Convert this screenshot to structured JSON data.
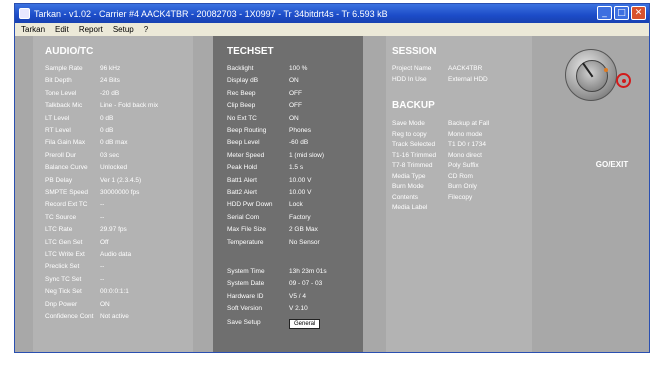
{
  "window": {
    "title": "Tarkan - v1.02 - Carrier #4   AACK4TBR - 20082703 - 1X0997   - Tr 34bitdrt4s - Tr 6.593 kB",
    "menu": [
      "Tarkan",
      "Edit",
      "Report",
      "Setup",
      "?"
    ],
    "buttons": {
      "minimize": "_",
      "maximize": "□",
      "close": "✕"
    }
  },
  "audio": {
    "title": "AUDIO/TC",
    "rows": [
      {
        "k": "Sample Rate",
        "v": "96 kHz"
      },
      {
        "k": "Bit Depth",
        "v": "24 Bits"
      },
      {
        "k": "Tone Level",
        "v": "-20 dB"
      },
      {
        "k": "Talkback Mic",
        "v": "Line - Fold back mix"
      },
      {
        "k": "LT Level",
        "v": "0 dB"
      },
      {
        "k": "RT Level",
        "v": "0 dB"
      },
      {
        "k": "Fila Gain Max",
        "v": "0 dB max"
      },
      {
        "k": "Preroll Dur",
        "v": "03 sec"
      },
      {
        "k": "Balance Curve",
        "v": "Unlocked"
      },
      {
        "k": "PB Delay",
        "v": "Ver 1 (2.3.4.5)"
      },
      {
        "k": "SMPTE Speed",
        "v": "30000000 fps"
      },
      {
        "k": "Record Ext TC",
        "v": "--"
      },
      {
        "k": "TC Source",
        "v": "--"
      },
      {
        "k": "LTC Rate",
        "v": "29.97 fps"
      },
      {
        "k": "LTC Gen Set",
        "v": "Off"
      },
      {
        "k": "LTC Write Ext",
        "v": "Audio data"
      },
      {
        "k": "Preclick Set",
        "v": "--"
      },
      {
        "k": "Sync TC Set",
        "v": "--"
      },
      {
        "k": "Neg Tick Set",
        "v": "00:0:0:1:1"
      },
      {
        "k": "Dnp Power",
        "v": "ON"
      },
      {
        "k": "Confidence Cont",
        "v": "Not active"
      }
    ]
  },
  "techset": {
    "title": "TECHSET",
    "rows": [
      {
        "k": "Backlight",
        "v": "100 %"
      },
      {
        "k": "Display dB",
        "v": "ON"
      },
      {
        "k": "Rec Beep",
        "v": "OFF"
      },
      {
        "k": "Clip Beep",
        "v": "OFF"
      },
      {
        "k": "No Ext TC",
        "v": "ON"
      },
      {
        "k": "Beep Routing",
        "v": "Phones"
      },
      {
        "k": "Beep Level",
        "v": "-60 dB"
      },
      {
        "k": "Meter Speed",
        "v": "1 (mid slow)"
      },
      {
        "k": "Peak Hold",
        "v": "1.5 s"
      },
      {
        "k": "Batt1 Alert",
        "v": "10.00 V"
      },
      {
        "k": "Batt2 Alert",
        "v": "10.00 V"
      },
      {
        "k": "HDD Pwr Down",
        "v": "Lock"
      },
      {
        "k": "Serial Com",
        "v": "Factory"
      },
      {
        "k": "Max File Size",
        "v": "2 GB Max"
      },
      {
        "k": "Temperature",
        "v": "No Sensor"
      }
    ],
    "system": [
      {
        "k": "System Time",
        "v": "13h 23m 01s"
      },
      {
        "k": "System Date",
        "v": "09 - 07 - 03"
      },
      {
        "k": "Hardware ID",
        "v": "V5 / 4"
      },
      {
        "k": "Soft Version",
        "v": "V 2.10"
      }
    ],
    "save_label": "Save Setup",
    "save_button": "General"
  },
  "session": {
    "title": "SESSION",
    "rows": [
      {
        "k": "Project Name",
        "v": "AACK4TBR"
      },
      {
        "k": "HDD In Use",
        "v": "External HDD"
      }
    ]
  },
  "backup": {
    "title": "BACKUP",
    "rows": [
      {
        "k": "Save Mode",
        "v": "Backup at Fall"
      },
      {
        "k": "Reg to copy",
        "v": "Mono mode"
      },
      {
        "k": "Track Selected",
        "v": "T1 D0 r 1734"
      },
      {
        "k": "T1-16 Trimmed",
        "v": "Mono direct"
      },
      {
        "k": "T7-8 Trimmed",
        "v": "Poly Suffix"
      },
      {
        "k": "Media Type",
        "v": "CD Rom"
      },
      {
        "k": "Burn Mode",
        "v": "Burn Only"
      },
      {
        "k": "Contents",
        "v": "Filecopy"
      },
      {
        "k": "Media Label",
        "v": ""
      }
    ]
  },
  "knob": {
    "label": "GO/EXIT"
  }
}
